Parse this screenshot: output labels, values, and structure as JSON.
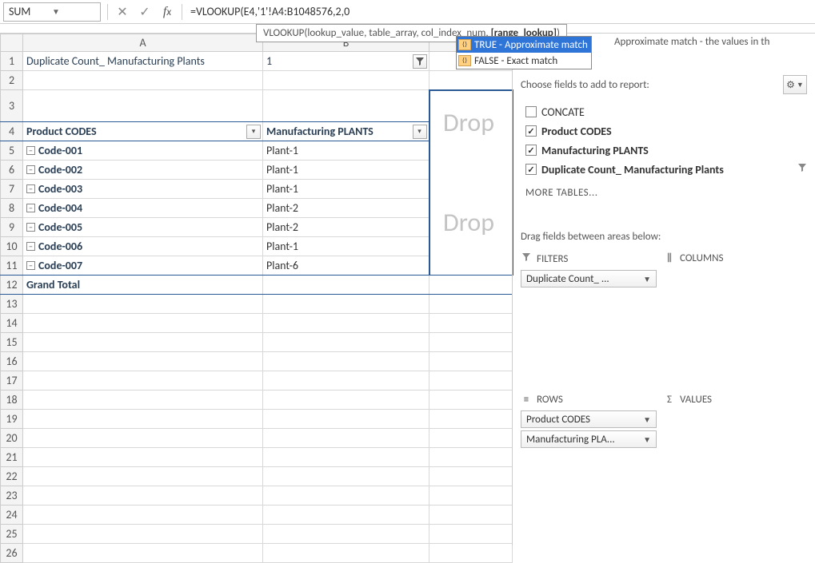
{
  "nameBox": "SUM",
  "formula": "=VLOOKUP(E4,'1'!A4:B1048576,2,0",
  "tooltip": {
    "prefix": "VLOOKUP(lookup_value, table_array, col_index_num, ",
    "bold": "[range_lookup]",
    "suffix": ")"
  },
  "autocomplete": {
    "items": [
      {
        "label": "TRUE - Approximate match",
        "selected": true
      },
      {
        "label": "FALSE - Exact match",
        "selected": false
      }
    ],
    "hint": "Approximate match - the values in th"
  },
  "columns": [
    "A",
    "B"
  ],
  "pivot": {
    "filterLabel": "Duplicate Count_ Manufacturing Plants",
    "filterValue": "1",
    "hdrA": "Product CODES",
    "hdrB": "Manufacturing PLANTS",
    "rows": [
      {
        "code": "Code-001",
        "plant": "Plant-1"
      },
      {
        "code": "Code-002",
        "plant": "Plant-1"
      },
      {
        "code": "Code-003",
        "plant": "Plant-1"
      },
      {
        "code": "Code-004",
        "plant": "Plant-2"
      },
      {
        "code": "Code-005",
        "plant": "Plant-2"
      },
      {
        "code": "Code-006",
        "plant": "Plant-1"
      },
      {
        "code": "Code-007",
        "plant": "Plant-6"
      }
    ],
    "grandTotal": "Grand Total"
  },
  "dropWatermark": "Drop",
  "pane": {
    "chooseLabel": "Choose fields to add to report:",
    "fields": [
      {
        "label": "CONCATE",
        "checked": false,
        "bold": false,
        "filter": false
      },
      {
        "label": "Product CODES",
        "checked": true,
        "bold": true,
        "filter": false
      },
      {
        "label": "Manufacturing PLANTS",
        "checked": true,
        "bold": true,
        "filter": false
      },
      {
        "label": "Duplicate Count_ Manufacturing Plants",
        "checked": true,
        "bold": true,
        "filter": true
      }
    ],
    "moreTables": "MORE TABLES...",
    "dragLabel": "Drag fields between areas below:",
    "areas": {
      "filters": {
        "title": "FILTERS",
        "pills": [
          "Duplicate Count_ ..."
        ]
      },
      "columns": {
        "title": "COLUMNS",
        "pills": []
      },
      "rows": {
        "title": "ROWS",
        "pills": [
          "Product CODES",
          "Manufacturing PLA..."
        ]
      },
      "values": {
        "title": "VALUES",
        "pills": []
      }
    }
  }
}
